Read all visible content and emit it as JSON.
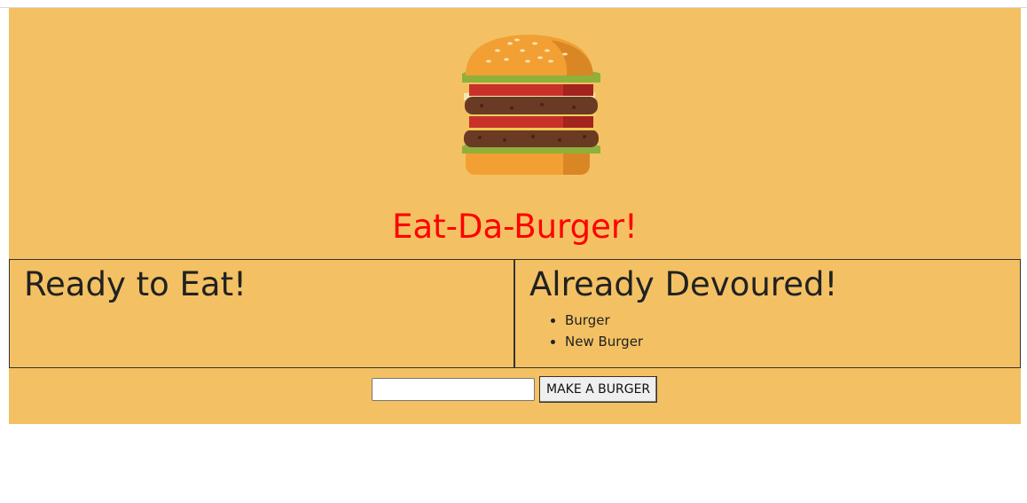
{
  "header": {
    "title": "Eat-Da-Burger!"
  },
  "columns": {
    "ready": {
      "heading": "Ready to Eat!",
      "items": []
    },
    "devoured": {
      "heading": "Already Devoured!",
      "items": [
        "Burger",
        "New Burger"
      ]
    }
  },
  "form": {
    "input_value": "",
    "submit_label": "MAKE A BURGER"
  },
  "colors": {
    "background": "#f3c163",
    "title": "#ff0000"
  }
}
